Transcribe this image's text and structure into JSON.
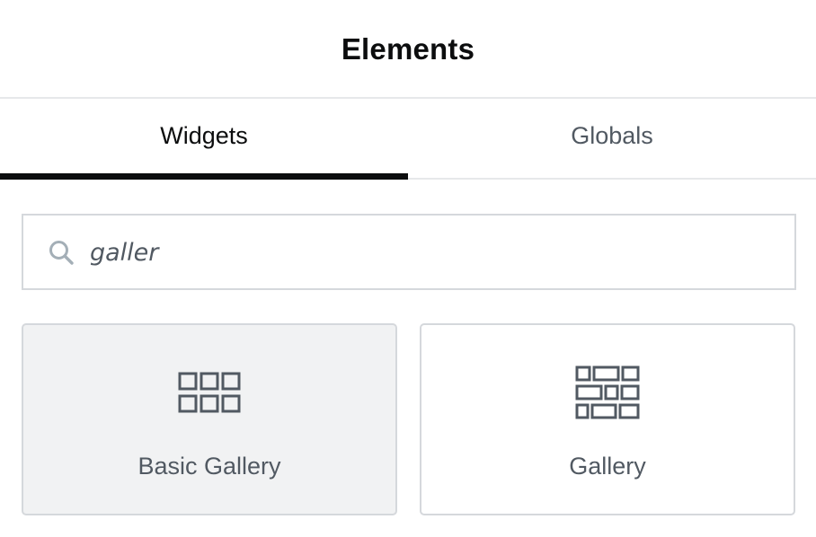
{
  "header": {
    "title": "Elements"
  },
  "tabs": [
    {
      "label": "Widgets",
      "active": true
    },
    {
      "label": "Globals",
      "active": false
    }
  ],
  "search": {
    "value": "galler",
    "icon": "search-icon"
  },
  "widgets": [
    {
      "label": "Basic Gallery",
      "icon": "basic-gallery-icon",
      "hovered": true
    },
    {
      "label": "Gallery",
      "icon": "gallery-icon",
      "hovered": false
    }
  ],
  "colors": {
    "text_primary": "#0c0d0e",
    "text_secondary": "#515962",
    "border": "#d5d8dc",
    "hover_bg": "#f1f2f3",
    "icon": "#515962"
  }
}
